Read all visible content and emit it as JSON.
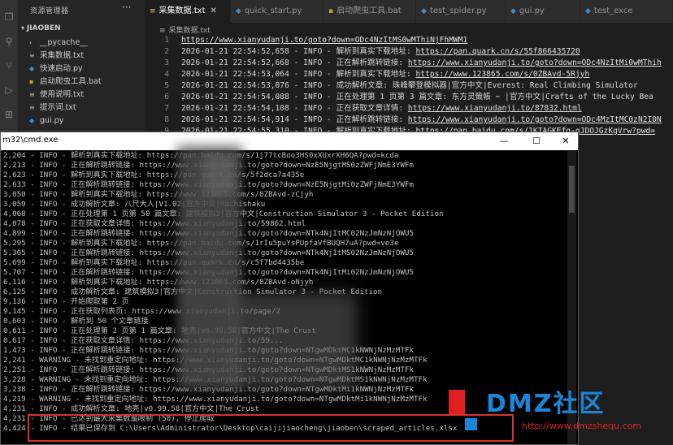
{
  "sidebar": {
    "title": "资源管理器",
    "folder": "JIAOBEN",
    "items": [
      {
        "icon": "folder",
        "label": "__pycache__"
      },
      {
        "icon": "txt",
        "label": "采集数据.txt"
      },
      {
        "icon": "py",
        "label": "快速启动.py"
      },
      {
        "icon": "bat",
        "label": "启动爬虫工具.bat"
      },
      {
        "icon": "txt",
        "label": "使用说明.txt"
      },
      {
        "icon": "txt",
        "label": "提示词.txt"
      },
      {
        "icon": "py",
        "label": "gui.py"
      }
    ]
  },
  "tabs": [
    {
      "label": "采集数据.txt",
      "active": true
    },
    {
      "label": "quick_start.py"
    },
    {
      "label": "启动爬虫工具.bat"
    },
    {
      "label": "test_spider.py"
    },
    {
      "label": "gui.py"
    },
    {
      "label": "test_exce"
    }
  ],
  "breadcrumb": "采集数据.txt",
  "editor": {
    "lines": [
      {
        "n": "1",
        "t": "",
        "u": "https://www.xianyudanji.to/goto?down=ODc4NzItMS0wMThiNjFhMWM1"
      },
      {
        "n": "2",
        "t": "2026-01-21 22:54:52,658 - INFO - 解析到真实下载地址: ",
        "u": "https://pan.quark.cn/s/55f866435720"
      },
      {
        "n": "3",
        "t": "2026-01-21 22:54:52,668 - INFO - 正在解析跳转链接: ",
        "u": "https://www.xianyudanji.to/goto?down=ODc4NzItMi0wMThih"
      },
      {
        "n": "4",
        "t": "2026-01-21 22:54:53,064 - INFO - 解析到真实下载地址: ",
        "u": "https://www.123865.com/s/0ZBAvd-5Rjyh"
      },
      {
        "n": "5",
        "t": "2026-01-21 22:54:53,076 - INFO - 成功解析文章: 珠峰攀登模拟器|官方中文|Everest: Real Climbing Simulator",
        "u": ""
      },
      {
        "n": "6",
        "t": "2026-01-21 22:54:54,088 - INFO - 正在处理第 1 页第 3 篇文章: 东方灵籤帳 ~ |官方中文|Crafts of the Lucky Bea",
        "u": ""
      },
      {
        "n": "7",
        "t": "2026-01-21 22:54:54,108 - INFO - 正在获取文章详情: ",
        "u": "https://www.xianyudanji.to/87832.html"
      },
      {
        "n": "8",
        "t": "2026-01-21 22:54:54,914 - INFO - 正在解析跳转链接: ",
        "u": "https://www.xianyudanji.to/goto?down=ODc4MzItMC0zN2I0N"
      },
      {
        "n": "9",
        "t": "2026-01-21 22:54:55,310 - INFO - 解析到真实下载地址: ",
        "u": "https://pan.baidu.com/s/1KIAGKEfg-gJDOJGzKgVrw?pwd="
      }
    ]
  },
  "cmd": {
    "title": "m32\\cmd.exe",
    "buttons": {
      "min": "—",
      "max": "☐",
      "close": "✕"
    },
    "lines": [
      "2,204 - INFO - 解析到真实下载地址: https://pan.baidu.com/s/1j77tcBoo3HS0xXUxrXH6QA?pwd=kcda",
      "2,213 - INFO - 正在解析跳转链接: https://www.xianyudanji.to/goto?down=NzE5NjgtMS0zZWFjNmE3YWFm",
      "2,623 - INFO - 解析到真实下载地址: https://pan.quark.cn/s/5f2dca7a435e",
      "2,633 - INFO - 正在解析跳转链接: https://www.xianyudanji.to/goto?down=NzE5NjgtMi0zZWFjNmE3YWFm",
      "3,050 - INFO - 解析到真实下载地址: https://www.123865.com/s/0ZBAvd-zCjyh",
      "3,059 - INFO - 成功解析文章: 八尺大人|V1.02|官方中文|Hachishaku",
      "4,068 - INFO - 正在处理第 1 页第 50 篇文章: 建筑模拟3|官方中文|Construction Simulator 3 - Pocket Edition",
      "4,078 - INFO - 正在获取文章详情: https://www.xianyudanji.to/59862.html",
      "4,899 - INFO - 正在解析跳转链接: https://www.xianyudanji.to/goto?down=NTk4NjItMC02NzJmNzNjOWU5",
      "5,295 - INFO - 解析到真实下载地址: https://pan.baidu.com/s/1rIu5puYsPUpfaVfBUQH7uA?pwd=ve3e",
      "5,305 - INFO - 正在解析跳转链接: https://www.xianyudanji.to/goto?down=NTk4NjItMS02NzJmNzNjOWU5",
      "5,699 - INFO - 解析到真实下载地址: https://pan.quark.cn/s/c5f7bd4435be",
      "5,707 - INFO - 正在解析跳转链接: https://www.xianyudanji.to/goto?down=NTk4NjItMi02NzJmNzNjOWU5",
      "6,116 - INFO - 解析到真实下载地址: https://www.123865.com/s/0ZBAvd-oNjyh",
      "6,125 - INFO - 成功解析文章: 建筑模拟3|官方中文|Construction Simulator 3 - Pocket Edition",
      "9,136 - INFO - 开始爬取第 2 页",
      "9,145 - INFO - 正在获取列表页: https://www.xianyudanji.to/page/2",
      "0,603 - INFO - 解析到 50 个文章链接",
      "0,611 - INFO - 正在处理第 2 页第 1 篇文章: 地壳|v0.99.58|官方中文|The Crust",
      "0,617 - INFO - 正在获取文章详情: https://www.xianyudanji.to/59...",
      "1,473 - INFO - 正在解析跳转链接: https://www.xianyudanji.to/goto?down=NTgwMDktMC1kNWNjNzMzMTFk",
      "2,241 - WARNING - 未找到重定向地址: https://www.xianyudanji.to/goto?down=NTgwMDktMC1kNWNjNzMzMTFk",
      "2,251 - INFO - 正在解析跳转链接: https://www.xianyudanji.to/goto?down=NTgwMDktMS1kNWNjNzMzMTFk",
      "3,228 - WARNING - 未找到重定向地址: https://www.xianyudanji.to/goto?down=NTgwMDktMS1kNWNjNzMzMTFk",
      "3,238 - INFO - 正在解析跳转链接: https://www.xianyudanji.to/goto?down=NTgwMDktMi1kNWNjNzMzMTFk",
      "4,219 - WARNING - 未找到重定向地址: https://www.xianyudanji.to/goto?down=NTgwMDktMi1kNWNjNzMzMTFk",
      "4,231 - INFO - 成功解析文章: 地壳|v0.99.58|官方中文|The Crust",
      "4,231 - INFO - 已达到最大采集数量限制 (50), 停止爬取",
      "4,424 - INFO - 结果已保存到 C:\\Users\\Administrator\\Desktop\\caijijiaocheng\\jiaoben\\scraped_articles.xlsx"
    ]
  },
  "watermark": {
    "text": "DMZ社区",
    "url": "http://www.dmzshequ.com"
  },
  "colors": {
    "highlight": "#d83232",
    "watermark_red": "#e02020",
    "watermark_blue": "#1a86d8"
  }
}
